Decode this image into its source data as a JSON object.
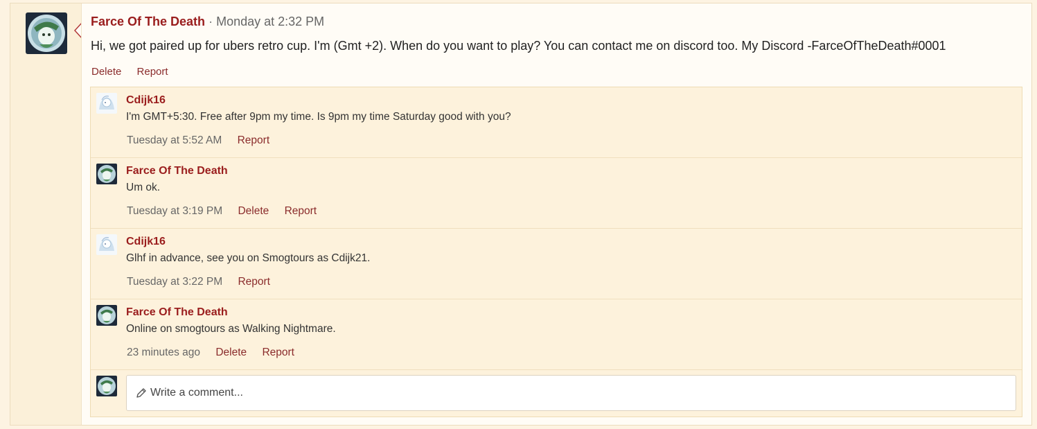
{
  "post": {
    "author": "Farce Of The Death",
    "separator": "·",
    "time": "Monday at 2:32 PM",
    "body": "Hi, we got paired up for ubers retro cup. I'm (Gmt +2). When do you want to play? You can contact me on discord too. My Discord -FarceOfTheDeath#0001",
    "actions": {
      "delete": "Delete",
      "report": "Report"
    }
  },
  "comments": [
    {
      "author": "Cdijk16",
      "text": "I'm GMT+5:30. Free after 9pm my time. Is 9pm my time Saturday good with you?",
      "time": "Tuesday at 5:52 AM",
      "report": "Report"
    },
    {
      "author": "Farce Of The Death",
      "text": "Um ok.",
      "time": "Tuesday at 3:19 PM",
      "delete": "Delete",
      "report": "Report"
    },
    {
      "author": "Cdijk16",
      "text": "Glhf in advance, see you on Smogtours as Cdijk21.",
      "time": "Tuesday at 3:22 PM",
      "report": "Report"
    },
    {
      "author": "Farce Of The Death",
      "text": "Online on smogtours as Walking Nightmare.",
      "time": "23 minutes ago",
      "delete": "Delete",
      "report": "Report"
    }
  ],
  "write_comment": {
    "placeholder": "Write a comment..."
  },
  "colors": {
    "author": "#9a1d1d",
    "link": "#8a2b2b",
    "comment_bg": "#fdf2dc",
    "sidebar_bg": "#fbf0d9"
  },
  "icons": {
    "pencil": "pencil-icon",
    "avatar_farce": "avatar-farce-icon",
    "avatar_cdijk": "avatar-cdijk-icon"
  }
}
